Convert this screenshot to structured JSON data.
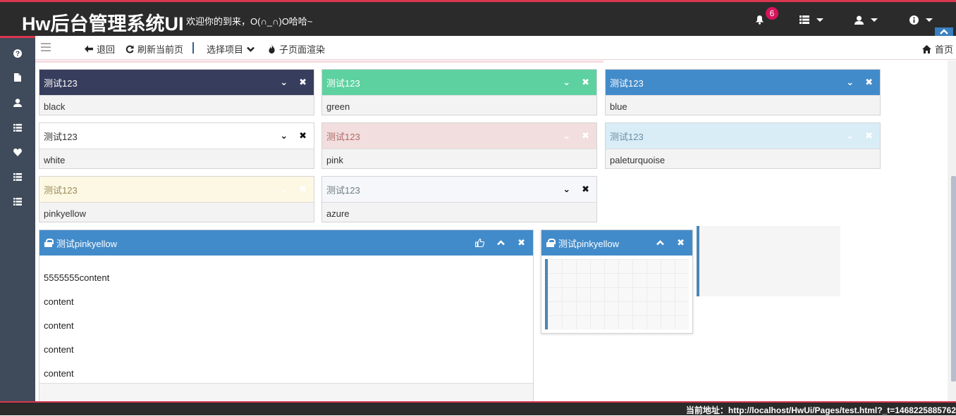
{
  "header": {
    "app_title": "Hw后台管理系统UI",
    "welcome": "欢迎你的到来，O(∩_∩)O哈哈~",
    "notification_count": "6"
  },
  "toolbar": {
    "back": "退回",
    "refresh": "刷新当前页",
    "select_project": "选择项目",
    "render_subpage": "子页面渲染",
    "home": "首页"
  },
  "panels": [
    {
      "title": "测试123",
      "body": "black",
      "header_color": "#373d5c",
      "title_color": "#ffffff"
    },
    {
      "title": "测试123",
      "body": "green",
      "header_color": "#5dd1a0",
      "title_color": "#ffffff"
    },
    {
      "title": "测试123",
      "body": "blue",
      "header_color": "#428bca",
      "title_color": "#ffffff"
    },
    {
      "title": "测试123",
      "body": "white",
      "header_color": "#ffffff",
      "title_color": "#333333"
    },
    {
      "title": "测试123",
      "body": "pink",
      "header_color": "#f2dede",
      "title_color": "#b06a6a"
    },
    {
      "title": "测试123",
      "body": "paleturquoise",
      "header_color": "#d9edf7",
      "title_color": "#6a8fa5"
    },
    {
      "title": "测试123",
      "body": "pinkyellow",
      "header_color": "#fcf8e3",
      "title_color": "#9c8b5a"
    },
    {
      "title": "测试123",
      "body": "azure",
      "header_color": "#f5f7fa",
      "title_color": "#6f7c87"
    }
  ],
  "big_panel": {
    "title": "测试pinkyellow",
    "lines": [
      "5555555content",
      "content",
      "content",
      "content",
      "content"
    ]
  },
  "small_panel": {
    "title": "测试pinkyellow"
  },
  "status": {
    "text": "当前地址：http://localhost/HwUi/Pages/test.html?_t=1468225885762"
  }
}
